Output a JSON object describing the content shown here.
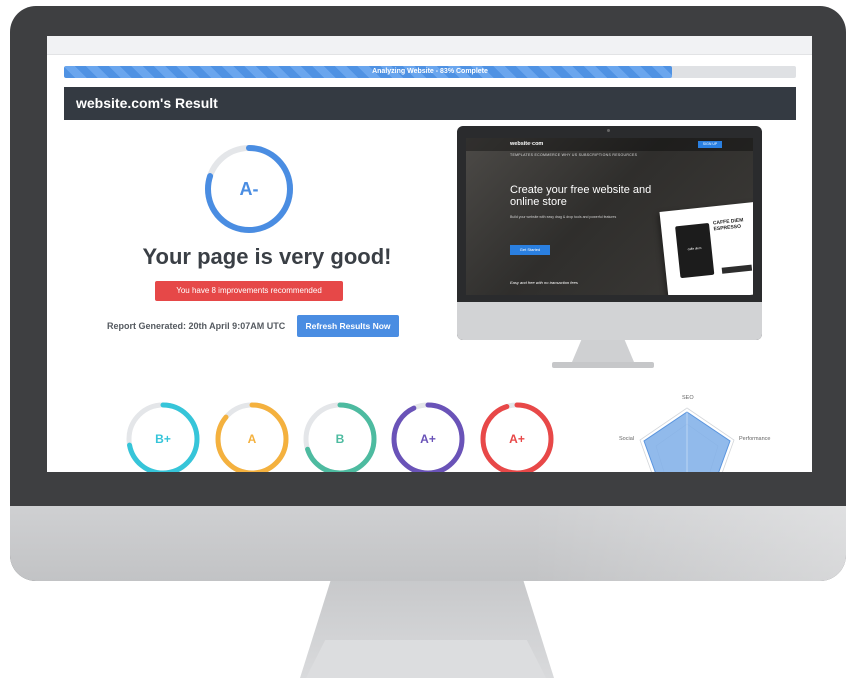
{
  "progress": {
    "label": "Analyzing Website - 83% Complete",
    "percent": 83
  },
  "result": {
    "title": "website.com's Result"
  },
  "main_grade": {
    "grade": "A-",
    "color": "#4a8de2",
    "fill": 0.8
  },
  "verdict": "Your page is very good!",
  "improvements_badge": "You have 8 improvements recommended",
  "report": {
    "generated_text": "Report Generated: 20th April 9:07AM UTC",
    "refresh_label": "Refresh Results Now"
  },
  "preview": {
    "logo": "website·com",
    "nav_links": "TEMPLATES     ECOMMERCE     WHY US     SUBSCRIPTIONS     RESOURCES",
    "signup": "SIGN UP",
    "hero": "Create your free website and online store",
    "sub": "Build your website with easy drag & drop tools and powerful features",
    "cta": "Get Started",
    "strip": "Easy and free with no transaction fees",
    "card_title": "CAFFE DIEM ESPRESSO",
    "bag_label": "caffe diem"
  },
  "sub_grades": [
    {
      "grade": "B+",
      "color": "#36c5d9",
      "fill": 0.72
    },
    {
      "grade": "A",
      "color": "#f4b13e",
      "fill": 0.86
    },
    {
      "grade": "B",
      "color": "#4dbba0",
      "fill": 0.7
    },
    {
      "grade": "A+",
      "color": "#6a53b8",
      "fill": 0.93
    },
    {
      "grade": "A+",
      "color": "#e84848",
      "fill": 0.95
    }
  ],
  "radar": {
    "labels": [
      "SEO",
      "Performance",
      "Social"
    ]
  },
  "colors": {
    "header_bg": "#343a42",
    "accent": "#4a8de2",
    "badge_red": "#e64848"
  }
}
